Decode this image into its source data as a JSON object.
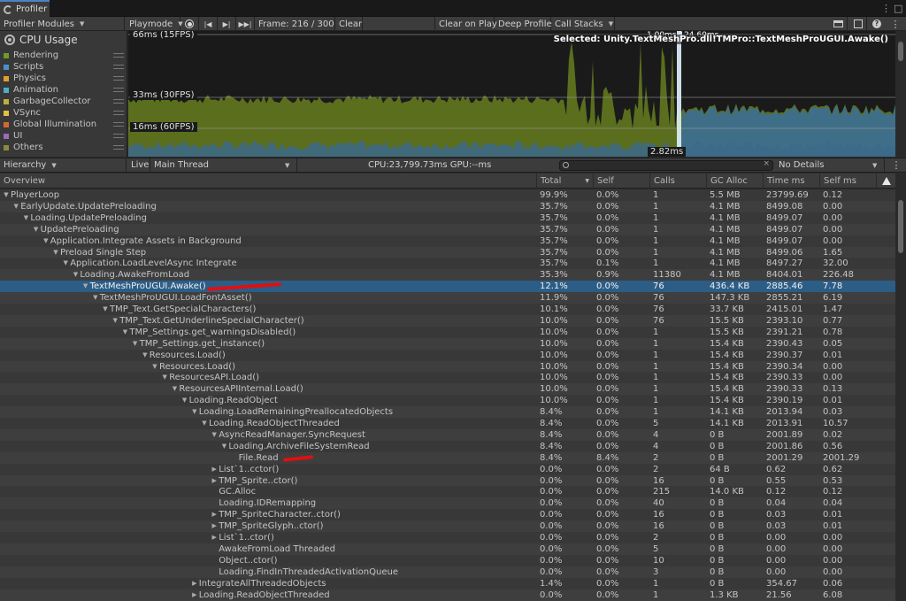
{
  "window": {
    "tab_title": "Profiler"
  },
  "toolbar": {
    "modules": "Profiler Modules",
    "mode": "Playmode",
    "frame": "Frame: 216 / 300",
    "clear": "Clear",
    "clear_on_play": "Clear on Play",
    "deep_profile": "Deep Profile",
    "call_stacks": "Call Stacks"
  },
  "cpu": {
    "title": "CPU Usage",
    "categories": [
      {
        "name": "Rendering",
        "color": "#6e9a2a"
      },
      {
        "name": "Scripts",
        "color": "#4a8fcc"
      },
      {
        "name": "Physics",
        "color": "#e0a030"
      },
      {
        "name": "Animation",
        "color": "#4ab0c8"
      },
      {
        "name": "GarbageCollector",
        "color": "#b8b040"
      },
      {
        "name": "VSync",
        "color": "#e0c040"
      },
      {
        "name": "Global Illumination",
        "color": "#d06a30"
      },
      {
        "name": "UI",
        "color": "#9c6ab8"
      },
      {
        "name": "Others",
        "color": "#8a8a3a"
      }
    ],
    "markers": [
      "66ms (15FPS)",
      "33ms (30FPS)",
      "16ms (60FPS)"
    ],
    "selected_label": "Selected: Unity.TextMeshPro.dll!TMPro::TextMeshProUGUI.Awake()",
    "cursor_value": "2.82ms",
    "cursor_overlay": "1.00ms  124.60ms"
  },
  "hierarchy_bar": {
    "view": "Hierarchy",
    "live": "Live",
    "thread": "Main Thread",
    "cpu_gpu": "CPU:23,799.73ms  GPU:--ms",
    "details": "No Details"
  },
  "columns": [
    "Overview",
    "Total",
    "Self",
    "Calls",
    "GC Alloc",
    "Time ms",
    "Self ms"
  ],
  "rows": [
    {
      "name": "PlayerLoop",
      "depth": 0,
      "arrow": "down",
      "total": "99.9%",
      "self": "0.0%",
      "calls": "1",
      "gc": "5.5 MB",
      "time": "23799.69",
      "selfms": "0.12"
    },
    {
      "name": "EarlyUpdate.UpdatePreloading",
      "depth": 1,
      "arrow": "down",
      "total": "35.7%",
      "self": "0.0%",
      "calls": "1",
      "gc": "4.1 MB",
      "time": "8499.08",
      "selfms": "0.00"
    },
    {
      "name": "Loading.UpdatePreloading",
      "depth": 2,
      "arrow": "down",
      "total": "35.7%",
      "self": "0.0%",
      "calls": "1",
      "gc": "4.1 MB",
      "time": "8499.07",
      "selfms": "0.00"
    },
    {
      "name": "UpdatePreloading",
      "depth": 3,
      "arrow": "down",
      "total": "35.7%",
      "self": "0.0%",
      "calls": "1",
      "gc": "4.1 MB",
      "time": "8499.07",
      "selfms": "0.00"
    },
    {
      "name": "Application.Integrate Assets in Background",
      "depth": 4,
      "arrow": "down",
      "total": "35.7%",
      "self": "0.0%",
      "calls": "1",
      "gc": "4.1 MB",
      "time": "8499.07",
      "selfms": "0.00"
    },
    {
      "name": "Preload Single Step",
      "depth": 5,
      "arrow": "down",
      "total": "35.7%",
      "self": "0.0%",
      "calls": "1",
      "gc": "4.1 MB",
      "time": "8499.06",
      "selfms": "1.65"
    },
    {
      "name": "Application.LoadLevelAsync Integrate",
      "depth": 6,
      "arrow": "down",
      "total": "35.7%",
      "self": "0.1%",
      "calls": "1",
      "gc": "4.1 MB",
      "time": "8497.27",
      "selfms": "32.00"
    },
    {
      "name": "Loading.AwakeFromLoad",
      "depth": 7,
      "arrow": "down",
      "total": "35.3%",
      "self": "0.9%",
      "calls": "11380",
      "gc": "4.1 MB",
      "time": "8404.01",
      "selfms": "226.48"
    },
    {
      "name": "TextMeshProUGUI.Awake()",
      "depth": 8,
      "arrow": "down",
      "total": "12.1%",
      "self": "0.0%",
      "calls": "76",
      "gc": "436.4 KB",
      "time": "2885.46",
      "selfms": "7.78",
      "selected": true
    },
    {
      "name": "TextMeshProUGUI.LoadFontAsset()",
      "depth": 9,
      "arrow": "down",
      "total": "11.9%",
      "self": "0.0%",
      "calls": "76",
      "gc": "147.3 KB",
      "time": "2855.21",
      "selfms": "6.19"
    },
    {
      "name": "TMP_Text.GetSpecialCharacters()",
      "depth": 10,
      "arrow": "down",
      "total": "10.1%",
      "self": "0.0%",
      "calls": "76",
      "gc": "33.7 KB",
      "time": "2415.01",
      "selfms": "1.47"
    },
    {
      "name": "TMP_Text.GetUnderlineSpecialCharacter()",
      "depth": 11,
      "arrow": "down",
      "total": "10.0%",
      "self": "0.0%",
      "calls": "76",
      "gc": "15.5 KB",
      "time": "2393.10",
      "selfms": "0.77"
    },
    {
      "name": "TMP_Settings.get_warningsDisabled()",
      "depth": 12,
      "arrow": "down",
      "total": "10.0%",
      "self": "0.0%",
      "calls": "1",
      "gc": "15.5 KB",
      "time": "2391.21",
      "selfms": "0.78"
    },
    {
      "name": "TMP_Settings.get_instance()",
      "depth": 13,
      "arrow": "down",
      "total": "10.0%",
      "self": "0.0%",
      "calls": "1",
      "gc": "15.4 KB",
      "time": "2390.43",
      "selfms": "0.05"
    },
    {
      "name": "Resources.Load()",
      "depth": 14,
      "arrow": "down",
      "total": "10.0%",
      "self": "0.0%",
      "calls": "1",
      "gc": "15.4 KB",
      "time": "2390.37",
      "selfms": "0.01"
    },
    {
      "name": "Resources.Load()",
      "depth": 15,
      "arrow": "down",
      "total": "10.0%",
      "self": "0.0%",
      "calls": "1",
      "gc": "15.4 KB",
      "time": "2390.34",
      "selfms": "0.00"
    },
    {
      "name": "ResourcesAPI.Load()",
      "depth": 16,
      "arrow": "down",
      "total": "10.0%",
      "self": "0.0%",
      "calls": "1",
      "gc": "15.4 KB",
      "time": "2390.33",
      "selfms": "0.00"
    },
    {
      "name": "ResourcesAPIInternal.Load()",
      "depth": 17,
      "arrow": "down",
      "total": "10.0%",
      "self": "0.0%",
      "calls": "1",
      "gc": "15.4 KB",
      "time": "2390.33",
      "selfms": "0.13"
    },
    {
      "name": "Loading.ReadObject",
      "depth": 18,
      "arrow": "down",
      "total": "10.0%",
      "self": "0.0%",
      "calls": "1",
      "gc": "15.4 KB",
      "time": "2390.19",
      "selfms": "0.01"
    },
    {
      "name": "Loading.LoadRemainingPreallocatedObjects",
      "depth": 19,
      "arrow": "down",
      "total": "8.4%",
      "self": "0.0%",
      "calls": "1",
      "gc": "14.1 KB",
      "time": "2013.94",
      "selfms": "0.03"
    },
    {
      "name": "Loading.ReadObjectThreaded",
      "depth": 20,
      "arrow": "down",
      "total": "8.4%",
      "self": "0.0%",
      "calls": "5",
      "gc": "14.1 KB",
      "time": "2013.91",
      "selfms": "10.57"
    },
    {
      "name": "AsyncReadManager.SyncRequest",
      "depth": 21,
      "arrow": "down",
      "total": "8.4%",
      "self": "0.0%",
      "calls": "4",
      "gc": "0 B",
      "time": "2001.89",
      "selfms": "0.02"
    },
    {
      "name": "Loading.ArchiveFileSystemRead",
      "depth": 22,
      "arrow": "down",
      "total": "8.4%",
      "self": "0.0%",
      "calls": "4",
      "gc": "0 B",
      "time": "2001.86",
      "selfms": "0.56"
    },
    {
      "name": "File.Read",
      "depth": 23,
      "arrow": "none",
      "total": "8.4%",
      "self": "8.4%",
      "calls": "2",
      "gc": "0 B",
      "time": "2001.29",
      "selfms": "2001.29"
    },
    {
      "name": "List`1..cctor()",
      "depth": 21,
      "arrow": "right",
      "total": "0.0%",
      "self": "0.0%",
      "calls": "2",
      "gc": "64 B",
      "time": "0.62",
      "selfms": "0.62"
    },
    {
      "name": "TMP_Sprite..ctor()",
      "depth": 21,
      "arrow": "right",
      "total": "0.0%",
      "self": "0.0%",
      "calls": "16",
      "gc": "0 B",
      "time": "0.55",
      "selfms": "0.53"
    },
    {
      "name": "GC.Alloc",
      "depth": 21,
      "arrow": "none",
      "total": "0.0%",
      "self": "0.0%",
      "calls": "215",
      "gc": "14.0 KB",
      "time": "0.12",
      "selfms": "0.12"
    },
    {
      "name": "Loading.IDRemapping",
      "depth": 21,
      "arrow": "none",
      "total": "0.0%",
      "self": "0.0%",
      "calls": "40",
      "gc": "0 B",
      "time": "0.04",
      "selfms": "0.04"
    },
    {
      "name": "TMP_SpriteCharacter..ctor()",
      "depth": 21,
      "arrow": "right",
      "total": "0.0%",
      "self": "0.0%",
      "calls": "16",
      "gc": "0 B",
      "time": "0.03",
      "selfms": "0.01"
    },
    {
      "name": "TMP_SpriteGlyph..ctor()",
      "depth": 21,
      "arrow": "right",
      "total": "0.0%",
      "self": "0.0%",
      "calls": "16",
      "gc": "0 B",
      "time": "0.03",
      "selfms": "0.01"
    },
    {
      "name": "List`1..ctor()",
      "depth": 21,
      "arrow": "right",
      "total": "0.0%",
      "self": "0.0%",
      "calls": "2",
      "gc": "0 B",
      "time": "0.00",
      "selfms": "0.00"
    },
    {
      "name": "AwakeFromLoad Threaded",
      "depth": 21,
      "arrow": "none",
      "total": "0.0%",
      "self": "0.0%",
      "calls": "5",
      "gc": "0 B",
      "time": "0.00",
      "selfms": "0.00"
    },
    {
      "name": "Object..ctor()",
      "depth": 21,
      "arrow": "none",
      "total": "0.0%",
      "self": "0.0%",
      "calls": "10",
      "gc": "0 B",
      "time": "0.00",
      "selfms": "0.00"
    },
    {
      "name": "Loading.FindInThreadedActivationQueue",
      "depth": 21,
      "arrow": "none",
      "total": "0.0%",
      "self": "0.0%",
      "calls": "3",
      "gc": "0 B",
      "time": "0.00",
      "selfms": "0.00"
    },
    {
      "name": "IntegrateAllThreadedObjects",
      "depth": 19,
      "arrow": "right",
      "total": "1.4%",
      "self": "0.0%",
      "calls": "1",
      "gc": "0 B",
      "time": "354.67",
      "selfms": "0.06"
    },
    {
      "name": "Loading.ReadObjectThreaded",
      "depth": 19,
      "arrow": "right",
      "total": "0.0%",
      "self": "0.0%",
      "calls": "1",
      "gc": "1.3 KB",
      "time": "21.56",
      "selfms": "6.08"
    }
  ]
}
